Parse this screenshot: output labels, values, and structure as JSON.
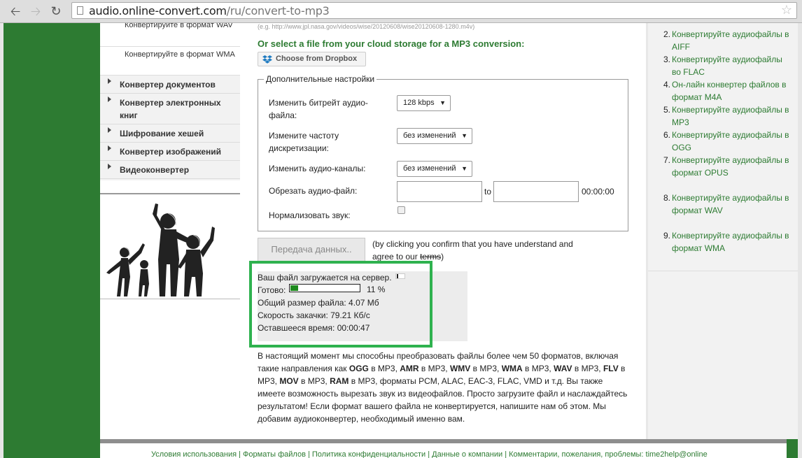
{
  "browser": {
    "url_host": "audio.online-convert.com",
    "url_path": "/ru/convert-to-mp3"
  },
  "sidebar": {
    "submenu": [
      {
        "label": "Конвертируйте в формат WAV"
      },
      {
        "label": "Конвертируйте в формат WMA"
      }
    ],
    "menu": [
      {
        "label": "Конвертер документов"
      },
      {
        "label": "Конвертер электронных книг"
      },
      {
        "label": "Шифрование хешей"
      },
      {
        "label": "Конвертер изображений"
      },
      {
        "label": "Видеоконвертер"
      }
    ]
  },
  "main": {
    "example_url": "(e.g. http://www.jpl.nasa.gov/videos/wise/20120608/wise20120608-1280.m4v)",
    "cloud_title": "Or select a file from your cloud storage for a MP3 conversion:",
    "dropbox_label": "Choose from Dropbox",
    "settings": {
      "legend": "Дополнительные настройки",
      "bitrate_label": "Изменить битрейт аудио-файла:",
      "bitrate_value": "128 kbps",
      "frequency_label": "Измените частоту дискретизации:",
      "frequency_value": "без изменений",
      "channels_label": "Изменить аудио-каналы:",
      "channels_value": "без изменений",
      "trim_label": "Обрезать аудио-файл:",
      "trim_to": "to",
      "trim_hint": "00:00:00",
      "normalize_label": "Нормализовать звук:"
    },
    "submit_label": "Передача данных..",
    "agree_text": "(by clicking you confirm that you have understand and agree to our",
    "terms_link": "terms",
    "agree_close": ")",
    "upload": {
      "uploading": "Ваш файл загружается на сервер.",
      "ready_label": "Готово:",
      "progress_percent": 11,
      "percent_text": "11 %",
      "size": "Общий размер файла: 4.07 Мб",
      "speed": "Скорость закачки: 79.21 Кб/с",
      "remaining": "Оставшееся время: 00:00:47"
    },
    "description": [
      {
        "t": "В настоящий момент мы способны преобразовать файлы более чем 50 форматов, включая такие направления как "
      },
      {
        "b": "OGG"
      },
      {
        "t": " в MP3, "
      },
      {
        "b": "AMR"
      },
      {
        "t": " в MP3, "
      },
      {
        "b": "WMV"
      },
      {
        "t": " в MP3, "
      },
      {
        "b": "WMA"
      },
      {
        "t": " в MP3, "
      },
      {
        "b": "WAV"
      },
      {
        "t": " в MP3, "
      },
      {
        "b": "FLV"
      },
      {
        "t": " в MP3, "
      },
      {
        "b": "MOV"
      },
      {
        "t": " в MP3, "
      },
      {
        "b": "RAM"
      },
      {
        "t": " в MP3, форматы PCM, ALAC, EAC-3, FLAC, VMD и т.д. Вы также имеете возможность вырезать звук из видеофайлов. Просто загрузите файл и наслаждайтесь результатом! Если формат вашего файла не конвертируется, напишите нам об этом. Мы добавим аудиоконвертер, необходимый именно вам."
      }
    ]
  },
  "right_list": [
    {
      "num": "2.",
      "label": "Конвертируйте аудиофайлы в AIFF"
    },
    {
      "num": "3.",
      "label": "Конвертируйте аудиофайлы во FLAC"
    },
    {
      "num": "4.",
      "label": "Он-лайн конвертер файлов в формат M4A"
    },
    {
      "num": "5.",
      "label": "Конвертируйте аудиофайлы в MP3"
    },
    {
      "num": "6.",
      "label": "Конвертируйте аудиофайлы в OGG"
    },
    {
      "num": "7.",
      "label": "Конвертируйте аудиофайлы в формат OPUS"
    },
    {
      "num": "8.",
      "label": "Конвертируйте аудиофайлы в формат WAV"
    },
    {
      "num": "9.",
      "label": "Конвертируйте аудиофайлы в формат WMA"
    }
  ],
  "footer": {
    "text": "Условия использования | Форматы файлов | Политика конфиденциальности | Данные о компании | Комментарии, пожелания, проблемы: time2help@online"
  },
  "colors": {
    "brand_green": "#2d7b32",
    "progress_green": "#1e8a1e",
    "highlight_green": "#2fb24f"
  }
}
